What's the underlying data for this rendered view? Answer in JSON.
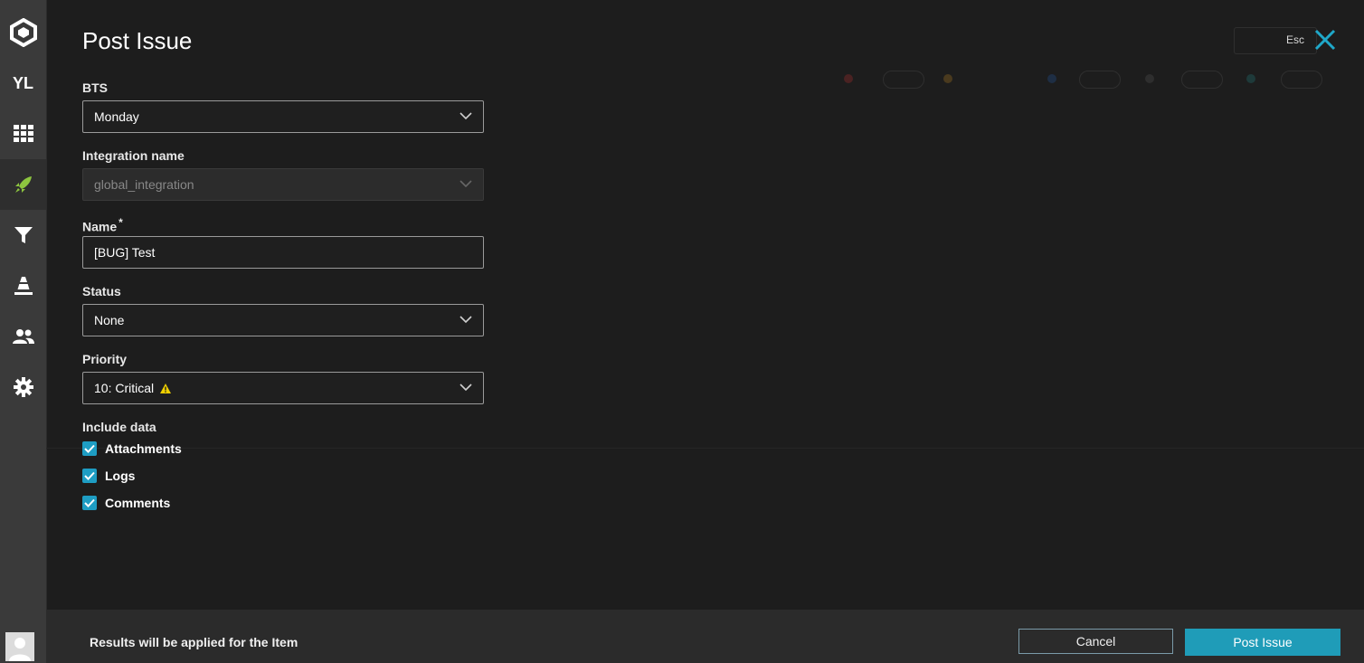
{
  "sidebar": {
    "logo_icon": "reportportal-logo-icon",
    "project_initials": "YL",
    "items": [
      {
        "icon": "dashboard-grid-icon"
      },
      {
        "icon": "launches-rocket-icon",
        "active": true
      },
      {
        "icon": "filter-icon"
      },
      {
        "icon": "debug-cone-icon"
      },
      {
        "icon": "members-icon"
      },
      {
        "icon": "settings-gear-icon"
      }
    ],
    "avatar_icon": "user-avatar-icon"
  },
  "modal": {
    "title": "Post Issue",
    "esc_label": "Esc",
    "close_icon": "close-x-icon",
    "fields": {
      "bts": {
        "label": "BTS",
        "value": "Monday"
      },
      "integration": {
        "label": "Integration name",
        "value": "global_integration"
      },
      "name": {
        "label": "Name",
        "required_mark": "*",
        "value": "[BUG] Test"
      },
      "status": {
        "label": "Status",
        "value": "None"
      },
      "priority": {
        "label": "Priority",
        "value": "10: Critical",
        "icon": "warning-triangle-icon"
      }
    },
    "include_data": {
      "label": "Include data",
      "options": [
        {
          "label": "Attachments",
          "checked": true
        },
        {
          "label": "Logs",
          "checked": true
        },
        {
          "label": "Comments",
          "checked": true
        }
      ]
    }
  },
  "footer": {
    "note": "Results will be applied for the Item",
    "cancel_label": "Cancel",
    "post_label": "Post Issue"
  },
  "colors": {
    "accent": "#1f9cb8",
    "checkbox": "#1e9dc3",
    "close": "#1fa8c9",
    "warning": "#f0d000",
    "sidebar_active_icon": "#8dc63f"
  }
}
